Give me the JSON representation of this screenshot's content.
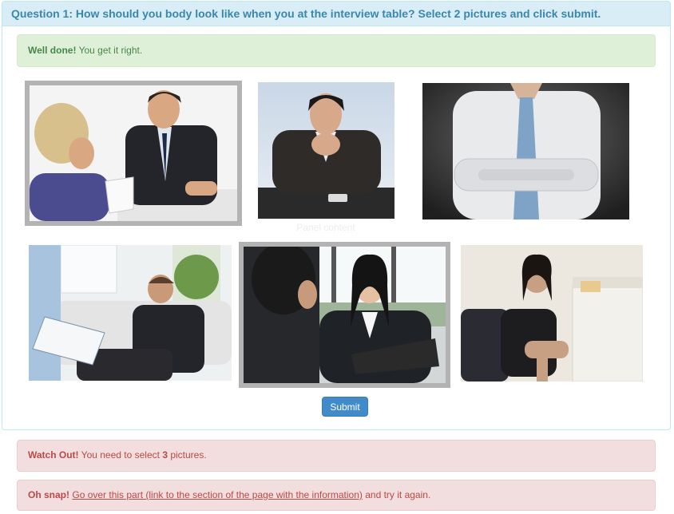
{
  "question": {
    "title": "Question 1: How should you body look like when you at the interview table? Select 2 pictures and click submit."
  },
  "feedback": {
    "success_strong": "Well done!",
    "success_text": " You get it right.",
    "watch_strong": "Watch Out!",
    "watch_pre": " You need to select ",
    "watch_count": "3",
    "watch_post": " pictures.",
    "snap_strong": "Oh snap!",
    "snap_link": "Go over this part (link to the section of the page with the information)",
    "snap_post": " and try it again."
  },
  "images": [
    {
      "id": "image-1",
      "selected": true
    },
    {
      "id": "image-2",
      "selected": false
    },
    {
      "id": "image-3",
      "selected": false
    },
    {
      "id": "image-4",
      "selected": false
    },
    {
      "id": "image-5",
      "selected": true
    },
    {
      "id": "image-6",
      "selected": false
    }
  ],
  "caption": "Panel content",
  "submit_label": "Submit",
  "colors": {
    "heading_bg": "#d9edf7",
    "heading_text": "#3a87ad",
    "success_bg": "#dff0d8",
    "success_text": "#468847",
    "danger_bg": "#f2dede",
    "danger_text": "#b94a48",
    "button_bg": "#428bca",
    "selected_border": "#b3b3b3"
  }
}
